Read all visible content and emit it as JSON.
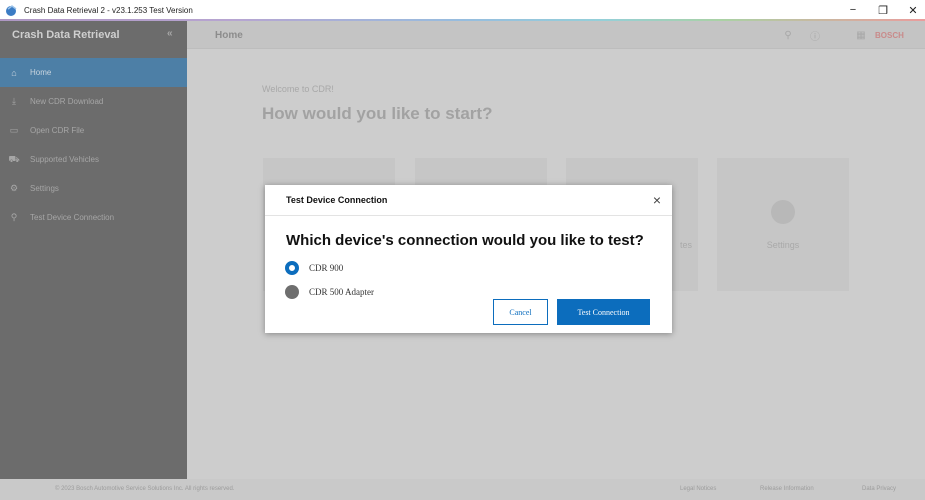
{
  "window": {
    "title": "Crash Data Retrieval 2 - v23.1.253 Test Version",
    "minimize": "−",
    "maximize": "❐",
    "close": "✕"
  },
  "sidebar": {
    "title": "Crash Data Retrieval",
    "collapse_icon": "«",
    "items": [
      {
        "label": "Home",
        "icon": "⌂"
      },
      {
        "label": "New CDR Download",
        "icon": "⤓"
      },
      {
        "label": "Open CDR File",
        "icon": "▭"
      },
      {
        "label": "Supported Vehicles",
        "icon": "⛟"
      },
      {
        "label": "Settings",
        "icon": "⚙"
      },
      {
        "label": "Test Device Connection",
        "icon": "⚲"
      }
    ]
  },
  "header": {
    "title": "Home",
    "brand": "BOSCH"
  },
  "home": {
    "welcome": "Welcome to CDR!",
    "headline": "How would you like to start?",
    "cards": [
      "",
      "",
      "tes",
      "Settings"
    ]
  },
  "footer": {
    "copyright": "© 2023 Bosch Automotive Service Solutions Inc. All rights reserved.",
    "links": [
      "Legal Notices",
      "Release Information",
      "Data Privacy"
    ]
  },
  "dialog": {
    "title": "Test Device Connection",
    "question": "Which device's connection would you like to test?",
    "options": [
      {
        "label": "CDR 900",
        "selected": true
      },
      {
        "label": "CDR 500 Adapter",
        "selected": false
      }
    ],
    "cancel_label": "Cancel",
    "confirm_label": "Test Connection"
  },
  "colors": {
    "accent": "#0c6dbd",
    "sidebar": "#6c6c6c",
    "sidebar_active": "#4d7fa6"
  }
}
